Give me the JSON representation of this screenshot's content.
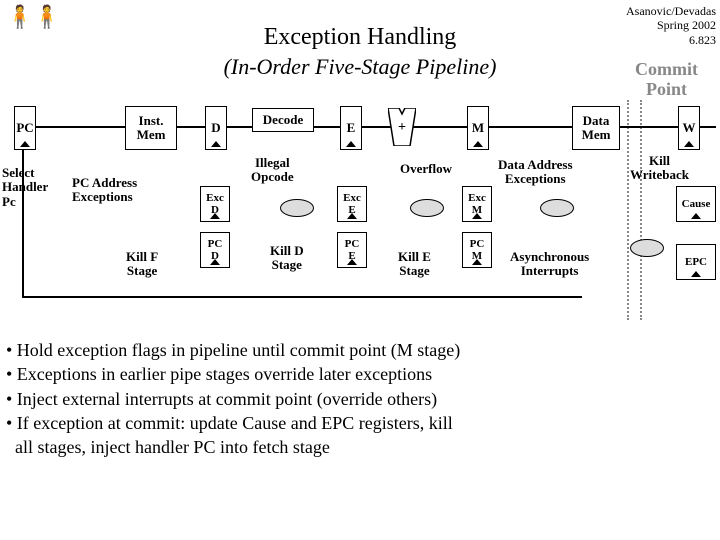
{
  "header": {
    "line1": "Asanovic/Devadas",
    "line2": "Spring 2002",
    "line3": "6.823"
  },
  "title": "Exception Handling",
  "subtitle": "(In-Order Five-Stage Pipeline)",
  "commit_point": "Commit\nPoint",
  "stages": {
    "pc": "PC",
    "inst_mem": "Inst.\nMem",
    "d": "D",
    "decode": "Decode",
    "e": "E",
    "alu": "+",
    "m": "M",
    "data_mem": "Data\nMem",
    "w": "W"
  },
  "mid": {
    "select_handler": "Select\nHandler\nPc",
    "pc_addr_exc": "PC Address\nExceptions",
    "illegal_opcode": "Illegal\nOpcode",
    "overflow": "Overflow",
    "data_addr_exc": "Data Address\nExceptions",
    "kill_wb": "Kill\nWriteback",
    "exc_d": "Exc\nD",
    "exc_e": "Exc\nE",
    "exc_m": "Exc\nM",
    "cause": "Cause"
  },
  "bottom": {
    "kill_f": "Kill F\nStage",
    "pc_d": "PC\nD",
    "kill_d": "Kill D\nStage",
    "pc_e": "PC\nE",
    "kill_e": "Kill E\nStage",
    "pc_m": "PC\nM",
    "async_int": "Asynchronous\nInterrupts",
    "epc": "EPC"
  },
  "bullets": [
    "• Hold exception flags in pipeline until commit point (M stage)",
    "• Exceptions in earlier pipe stages override later exceptions",
    "• Inject external interrupts at commit point (override others)",
    "• If exception at commit: update Cause and EPC registers, kill",
    "  all stages, inject handler PC into fetch stage"
  ]
}
